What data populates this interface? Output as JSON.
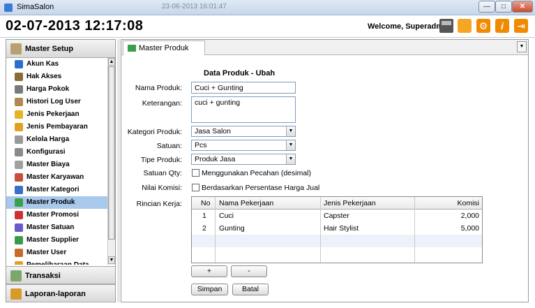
{
  "window": {
    "title": "SimaSalon",
    "ghost_title": "23-06-2013 16:01:47"
  },
  "header": {
    "clock": "02-07-2013 12:17:08",
    "welcome": "Welcome,  Superadmin",
    "icons": [
      "cash-register-icon",
      "fullscreen-icon",
      "gear-icon",
      "info-icon",
      "exit-icon"
    ]
  },
  "sidebar": {
    "master_setup": "Master Setup",
    "items": [
      {
        "label": "Akun Kas",
        "color": "#2a6fcf"
      },
      {
        "label": "Hak Akses",
        "color": "#8a6a3a"
      },
      {
        "label": "Harga Pokok",
        "color": "#7a7a7a"
      },
      {
        "label": "Histori Log User",
        "color": "#b08850"
      },
      {
        "label": "Jenis Pekerjaan",
        "color": "#e8b12a"
      },
      {
        "label": "Jenis Pembayaran",
        "color": "#e0a020"
      },
      {
        "label": "Kelola Harga",
        "color": "#9a9a9a"
      },
      {
        "label": "Konfigurasi",
        "color": "#8a8a8a"
      },
      {
        "label": "Master Biaya",
        "color": "#a0a0a0"
      },
      {
        "label": "Master Karyawan",
        "color": "#c8503a"
      },
      {
        "label": "Master Kategori",
        "color": "#3a70c8"
      },
      {
        "label": "Master Produk",
        "color": "#3aa04a"
      },
      {
        "label": "Master Promosi",
        "color": "#d03030"
      },
      {
        "label": "Master Satuan",
        "color": "#6a5ac8"
      },
      {
        "label": "Master Supplier",
        "color": "#3a9a4a"
      },
      {
        "label": "Master User",
        "color": "#c86a2a"
      },
      {
        "label": "Pemeliharaan Data",
        "color": "#e0a020"
      }
    ],
    "selected_index": 11,
    "transaksi": "Transaksi",
    "laporan": "Laporan-laporan"
  },
  "tab": {
    "label": "Master Produk"
  },
  "form": {
    "title": "Data Produk - Ubah",
    "nama_produk_label": "Nama Produk:",
    "nama_produk_value": "Cuci + Gunting",
    "keterangan_label": "Keterangan:",
    "keterangan_value": "cuci + gunting",
    "kategori_label": "Kategori Produk:",
    "kategori_value": "Jasa Salon",
    "satuan_label": "Satuan:",
    "satuan_value": "Pcs",
    "tipe_label": "Tipe Produk:",
    "tipe_value": "Produk Jasa",
    "satuan_qty_label": "Satuan Qty:",
    "satuan_qty_check": "Menggunakan Pecahan (desimal)",
    "nilai_komisi_label": "Nilai Komisi:",
    "nilai_komisi_check": "Berdasarkan Persentase Harga Jual",
    "rincian_label": "Rincian Kerja:"
  },
  "grid": {
    "headers": {
      "no": "No",
      "nama": "Nama Pekerjaan",
      "jenis": "Jenis Pekerjaan",
      "komisi": "Komisi"
    },
    "rows": [
      {
        "no": "1",
        "nama": "Cuci",
        "jenis": "Capster",
        "komisi": "2,000"
      },
      {
        "no": "2",
        "nama": "Gunting",
        "jenis": "Hair Stylist",
        "komisi": "5,000"
      }
    ]
  },
  "buttons": {
    "add": "+",
    "remove": "-",
    "save": "Simpan",
    "cancel": "Batal"
  }
}
